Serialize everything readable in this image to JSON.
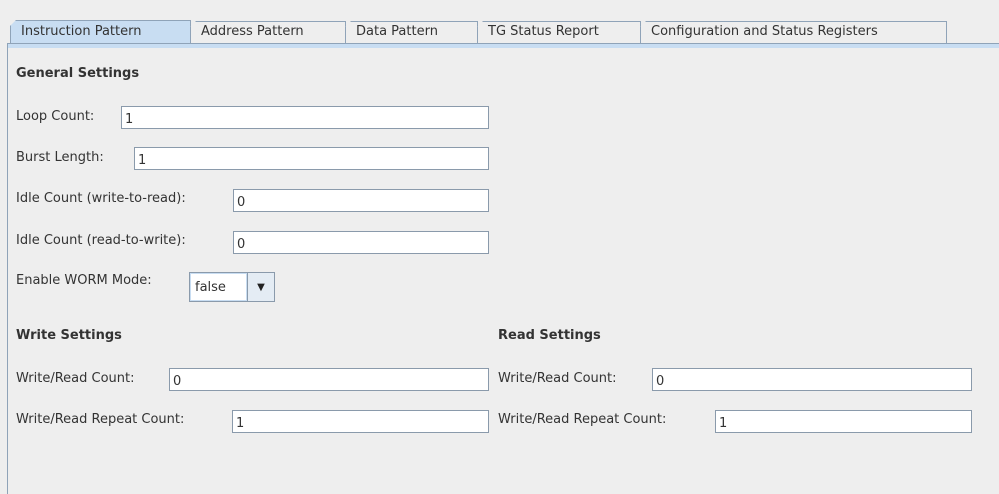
{
  "tabs": [
    {
      "label": "Instruction Pattern",
      "selected": true
    },
    {
      "label": "Address Pattern",
      "selected": false
    },
    {
      "label": "Data Pattern",
      "selected": false
    },
    {
      "label": "TG Status Report",
      "selected": false
    },
    {
      "label": "Configuration and Status Registers",
      "selected": false
    }
  ],
  "general": {
    "heading": "General Settings",
    "loop_count": {
      "label": "Loop Count:",
      "value": "1"
    },
    "burst_length": {
      "label": "Burst Length:",
      "value": "1"
    },
    "idle_w2r": {
      "label": "Idle Count (write-to-read):",
      "value": "0"
    },
    "idle_r2w": {
      "label": "Idle Count (read-to-write):",
      "value": "0"
    },
    "worm": {
      "label": "Enable WORM Mode:",
      "value": "false",
      "icon": "chevron-down-icon"
    }
  },
  "write": {
    "heading": "Write Settings",
    "count": {
      "label": "Write/Read Count:",
      "value": "0"
    },
    "repeat": {
      "label": "Write/Read Repeat Count:",
      "value": "1"
    }
  },
  "read": {
    "heading": "Read Settings",
    "count": {
      "label": "Write/Read Count:",
      "value": "0"
    },
    "repeat": {
      "label": "Write/Read Repeat Count:",
      "value": "1"
    }
  },
  "colors": {
    "accent": "#c8ddf2",
    "border": "#8fa3b8"
  }
}
